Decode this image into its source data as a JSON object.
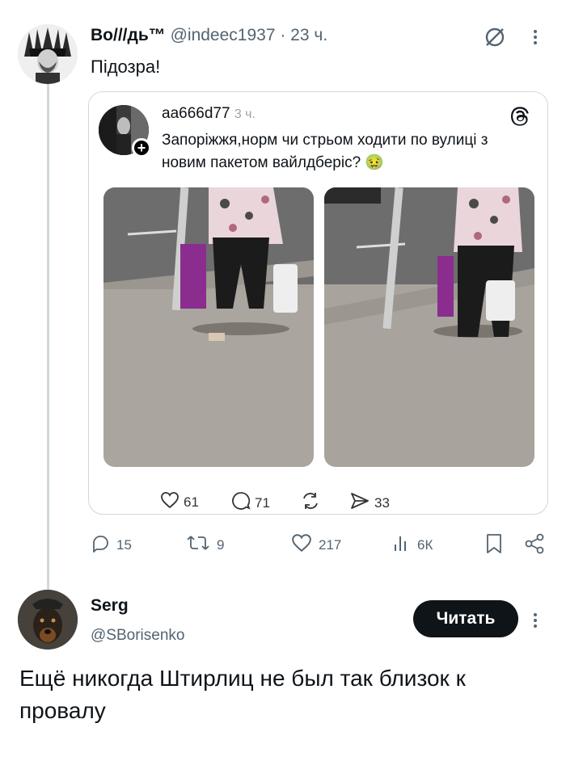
{
  "tweet": {
    "name": "Во///дь™",
    "handle": "@indeec1937",
    "time": "· 23 ч.",
    "text": "Підозра!",
    "actions": {
      "replies": "15",
      "reposts": "9",
      "likes": "217",
      "views": "6К"
    }
  },
  "quoted": {
    "name": "aa666d77",
    "time": "3 ч.",
    "text": "Запоріжжя,норм чи стрьом ходити по вулиці з новим пакетом вайлдберіс? 🤢",
    "actions": {
      "likes": "61",
      "replies": "71",
      "shares": "33"
    }
  },
  "reply": {
    "name": "Serg",
    "handle": "@SBorisenko",
    "follow_label": "Читать",
    "text": "Ещё никогда Штирлиц не был так близок к провалу"
  },
  "icons": [
    "no-entry-icon",
    "more-icon",
    "threads-icon",
    "heart-icon",
    "comment-icon",
    "repost-icon",
    "send-icon",
    "reply-icon",
    "views-icon",
    "bookmark-icon",
    "share-icon"
  ],
  "colors": {
    "text": "#0f1419",
    "secondary": "#536471",
    "border": "#cfd9de",
    "button": "#0f1419"
  }
}
